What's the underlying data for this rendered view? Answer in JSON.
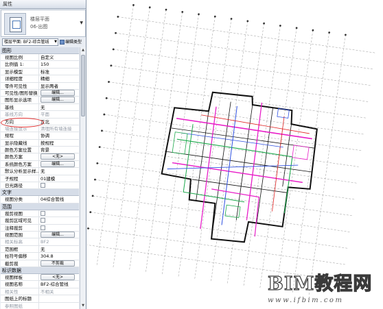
{
  "panel": {
    "title": "属性",
    "type_selector": {
      "family": "楼层平面",
      "type": "06-出图",
      "thumbnail_icon": "floor-plan-sheet-icon"
    },
    "instance_select": "楼层平面: BF2-综合管线",
    "edit_type_label": "编辑类型",
    "groups": [
      {
        "name": "图形",
        "rows": [
          {
            "key": "视图比例",
            "value": "自定义"
          },
          {
            "key": "比例值 1:",
            "value": "150"
          },
          {
            "key": "显示模型",
            "value": "标准"
          },
          {
            "key": "详细程度",
            "value": "精细"
          },
          {
            "key": "零件可见性",
            "value": "显示两者"
          },
          {
            "key": "可见性/图形替换",
            "button": "编辑..."
          },
          {
            "key": "图形显示选项",
            "button": "编辑..."
          },
          {
            "key": "基线",
            "value": "无"
          },
          {
            "key": "基线方向",
            "value": "平面",
            "dim": true
          },
          {
            "key": "方向",
            "value": "正北"
          },
          {
            "key": "墙连接显示",
            "value": "清理所有墙连接",
            "dim": true
          },
          {
            "key": "规程",
            "value": "协调"
          },
          {
            "key": "显示隐藏线",
            "value": "按规程"
          },
          {
            "key": "颜色方案位置",
            "value": "背景"
          },
          {
            "key": "颜色方案",
            "button": "<无>"
          },
          {
            "key": "系统颜色方案",
            "button": "编辑..."
          },
          {
            "key": "默认分析显示样...",
            "value": "无"
          },
          {
            "key": "子规程",
            "value": "01建模"
          },
          {
            "key": "日光路径",
            "checkbox": true
          }
        ]
      },
      {
        "name": "文字",
        "rows": [
          {
            "key": "视图分类",
            "value": "04综合管线"
          }
        ]
      },
      {
        "name": "范围",
        "rows": [
          {
            "key": "裁剪视图",
            "checkbox": true
          },
          {
            "key": "裁剪区域可见",
            "checkbox": true
          },
          {
            "key": "注释裁剪",
            "checkbox": true
          },
          {
            "key": "视图范围",
            "button": "编辑..."
          },
          {
            "key": "相关标高",
            "value": "BF2",
            "dim": true
          },
          {
            "key": "范围框",
            "value": "无"
          },
          {
            "key": "柱符号偏移",
            "value": "304.8"
          },
          {
            "key": "截剪裁",
            "button": "不剪裁"
          }
        ]
      },
      {
        "name": "标识数据",
        "rows": [
          {
            "key": "视图样板",
            "button": "<无>"
          },
          {
            "key": "视图名称",
            "value": "BF2-综合管线"
          },
          {
            "key": "相关性",
            "value": "不相关",
            "dim": true
          },
          {
            "key": "图纸上的标题",
            "value": ""
          },
          {
            "key": "参照图纸",
            "value": "",
            "dim": true
          }
        ]
      }
    ],
    "scroll_up_icon": "scroll-up-arrow-icon",
    "scroll_down_icon": "scroll-down-arrow-icon"
  },
  "canvas": {
    "description_icon": "rotated-floor-plan-drawing",
    "colors": {
      "grid_line": "#9a9a9a",
      "wall": "#111111",
      "pipe_magenta": "#e81ec8",
      "pipe_green": "#1aa84a",
      "pipe_blue": "#2d4fe0",
      "pipe_red": "#e02020"
    }
  },
  "watermark": {
    "title": "BIM教程网",
    "url": "www.ifbim.com"
  },
  "highlight_color": "#e23030"
}
